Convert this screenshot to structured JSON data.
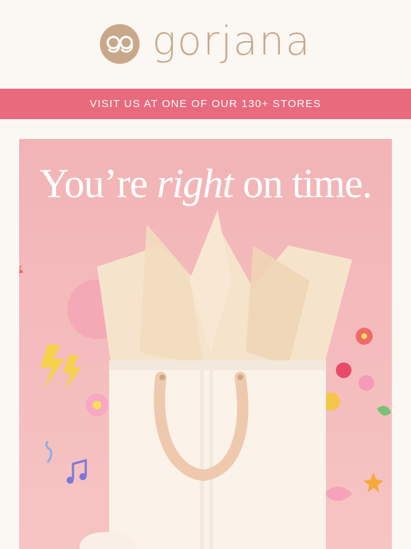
{
  "brand": {
    "name": "gorjana",
    "mark": "gg"
  },
  "banner": {
    "text": "VISIT US AT ONE OF OUR 130+ STORES"
  },
  "hero": {
    "headline_before": "You’re ",
    "headline_emphasis": "right",
    "headline_after": " on time.",
    "image_description_icon": "gift-bag-illustration"
  },
  "colors": {
    "background": "#fbf8f4",
    "brand_tan": "#c9a88a",
    "banner_pink": "#e86a7c",
    "hero_pink": "#f3b7b9"
  }
}
